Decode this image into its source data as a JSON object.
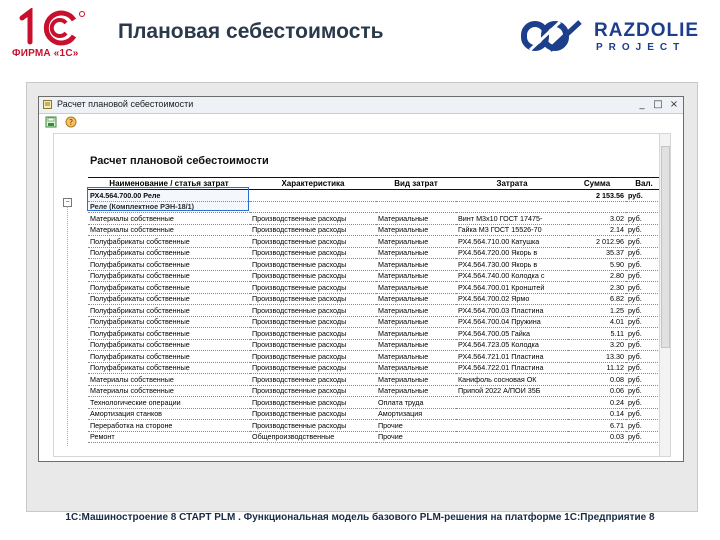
{
  "slide": {
    "title": "Плановая себестоимость",
    "brand_left": "ФИРМА «1С»",
    "brand_right_word": "RAZDOLIE",
    "brand_right_sub": "PROJECT",
    "footer": "1С:Машиностроение 8 СТАРТ PLM . Функциональная модель базового PLM-решения на платформе 1С:Предприятие 8",
    "colors": {
      "brand_red": "#c8102e",
      "brand_blue": "#1d3e8a",
      "title": "#2b3a4a"
    }
  },
  "window": {
    "title": "Расчет плановой себестоимости",
    "controls": [
      "_",
      "□",
      "×"
    ],
    "toolbar_icons": [
      "save-icon",
      "help-icon"
    ]
  },
  "report": {
    "title": "Расчет плановой себестоимости",
    "columns": [
      "Наименование / статья затрат",
      "Характеристика",
      "Вид затрат",
      "Затрата",
      "Сумма",
      "Вал."
    ],
    "rows": [
      {
        "style": "group",
        "cells": [
          "РХ4.564.700.00 Реле",
          "",
          "",
          "",
          "2 153.56",
          "руб."
        ]
      },
      {
        "style": "sub",
        "cells": [
          "Реле (Комплектное РЭН-18/1)",
          "",
          "",
          "",
          "",
          ""
        ]
      },
      {
        "style": "",
        "cells": [
          "Материалы собственные",
          "Производственные расходы",
          "Материальные",
          "Винт М3х10 ГОСТ 17475-",
          "3.02",
          "руб."
        ]
      },
      {
        "style": "",
        "cells": [
          "Материалы собственные",
          "Производственные расходы",
          "Материальные",
          "Гайка М3 ГОСТ 15526-70",
          "2.14",
          "руб."
        ]
      },
      {
        "style": "",
        "cells": [
          "Полуфабрикаты собственные",
          "Производственные расходы",
          "Материальные",
          "РХ4.564.710.00 Катушка",
          "2 012.96",
          "руб."
        ]
      },
      {
        "style": "",
        "cells": [
          "Полуфабрикаты собственные",
          "Производственные расходы",
          "Материальные",
          "РХ4.564.720.00 Якорь в",
          "35.37",
          "руб."
        ]
      },
      {
        "style": "",
        "cells": [
          "Полуфабрикаты собственные",
          "Производственные расходы",
          "Материальные",
          "РХ4.564.730.00 Якорь в",
          "5.90",
          "руб."
        ]
      },
      {
        "style": "",
        "cells": [
          "Полуфабрикаты собственные",
          "Производственные расходы",
          "Материальные",
          "РХ4.564.740.00 Колодка с",
          "2.80",
          "руб."
        ]
      },
      {
        "style": "",
        "cells": [
          "Полуфабрикаты собственные",
          "Производственные расходы",
          "Материальные",
          "РХ4.564.700.01 Кронштей",
          "2.30",
          "руб."
        ]
      },
      {
        "style": "",
        "cells": [
          "Полуфабрикаты собственные",
          "Производственные расходы",
          "Материальные",
          "РХ4.564.700.02 Ярмо",
          "6.82",
          "руб."
        ]
      },
      {
        "style": "",
        "cells": [
          "Полуфабрикаты собственные",
          "Производственные расходы",
          "Материальные",
          "РХ4.564.700.03 Пластина",
          "1.25",
          "руб."
        ]
      },
      {
        "style": "",
        "cells": [
          "Полуфабрикаты собственные",
          "Производственные расходы",
          "Материальные",
          "РХ4.564.700.04 Пружина",
          "4.01",
          "руб."
        ]
      },
      {
        "style": "",
        "cells": [
          "Полуфабрикаты собственные",
          "Производственные расходы",
          "Материальные",
          "РХ4.564.700.05 Гайка",
          "5.11",
          "руб."
        ]
      },
      {
        "style": "",
        "cells": [
          "Полуфабрикаты собственные",
          "Производственные расходы",
          "Материальные",
          "РХ4.564.723.05 Колодка",
          "3.20",
          "руб."
        ]
      },
      {
        "style": "",
        "cells": [
          "Полуфабрикаты собственные",
          "Производственные расходы",
          "Материальные",
          "РХ4.564.721.01 Пластина",
          "13.30",
          "руб."
        ]
      },
      {
        "style": "",
        "cells": [
          "Полуфабрикаты собственные",
          "Производственные расходы",
          "Материальные",
          "РХ4.564.722.01 Пластина",
          "11.12",
          "руб."
        ]
      },
      {
        "style": "",
        "cells": [
          "Материалы собственные",
          "Производственные расходы",
          "Материальные",
          "Канифоль сосновая ОК",
          "0.08",
          "руб."
        ]
      },
      {
        "style": "",
        "cells": [
          "Материалы собственные",
          "Производственные расходы",
          "Материальные",
          "Припой 2022 А/ПОИ 35Б",
          "0.06",
          "руб."
        ]
      },
      {
        "style": "",
        "cells": [
          "Технологические операции",
          "Производственные расходы",
          "Оплата труда",
          "",
          "0.24",
          "руб."
        ]
      },
      {
        "style": "",
        "cells": [
          "Амортизация станков",
          "Производственные расходы",
          "Амортизация",
          "",
          "0.14",
          "руб."
        ]
      },
      {
        "style": "",
        "cells": [
          "Переработка на стороне",
          "Производственные расходы",
          "Прочие",
          "",
          "6.71",
          "руб."
        ]
      },
      {
        "style": "",
        "cells": [
          "Ремонт",
          "Общепроизводственные",
          "Прочие",
          "",
          "0.03",
          "руб."
        ]
      }
    ]
  }
}
